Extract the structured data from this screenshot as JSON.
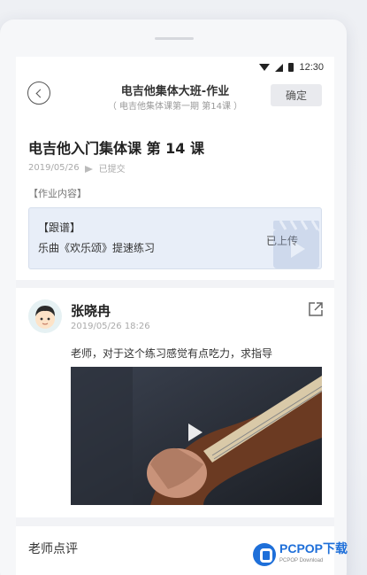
{
  "status_bar": {
    "time": "12:30"
  },
  "navbar": {
    "title": "电吉他集体大班-作业",
    "subtitle": "（ 电吉他集体课第一期 第14课 ）",
    "confirm_label": "确定"
  },
  "lesson": {
    "title": "电吉他入门集体课 第 14 课",
    "date": "2019/05/26",
    "submitted_label": "已提交",
    "section_label": "【作业内容】"
  },
  "homework_card": {
    "tag": "【跟谱】",
    "name": "乐曲《欢乐颂》提速练习",
    "status": "已上传"
  },
  "post": {
    "user_name": "张晓冉",
    "time": "2019/05/26  18:26",
    "comment": "老师，对于这个练习感觉有点吃力，求指导"
  },
  "review": {
    "title": "老师点评"
  },
  "watermark": {
    "brand": "PCPOP下载",
    "sub": "PCPOP Download"
  },
  "colors": {
    "accent": "#1e6fd9",
    "card_bg": "#e8eef8"
  }
}
